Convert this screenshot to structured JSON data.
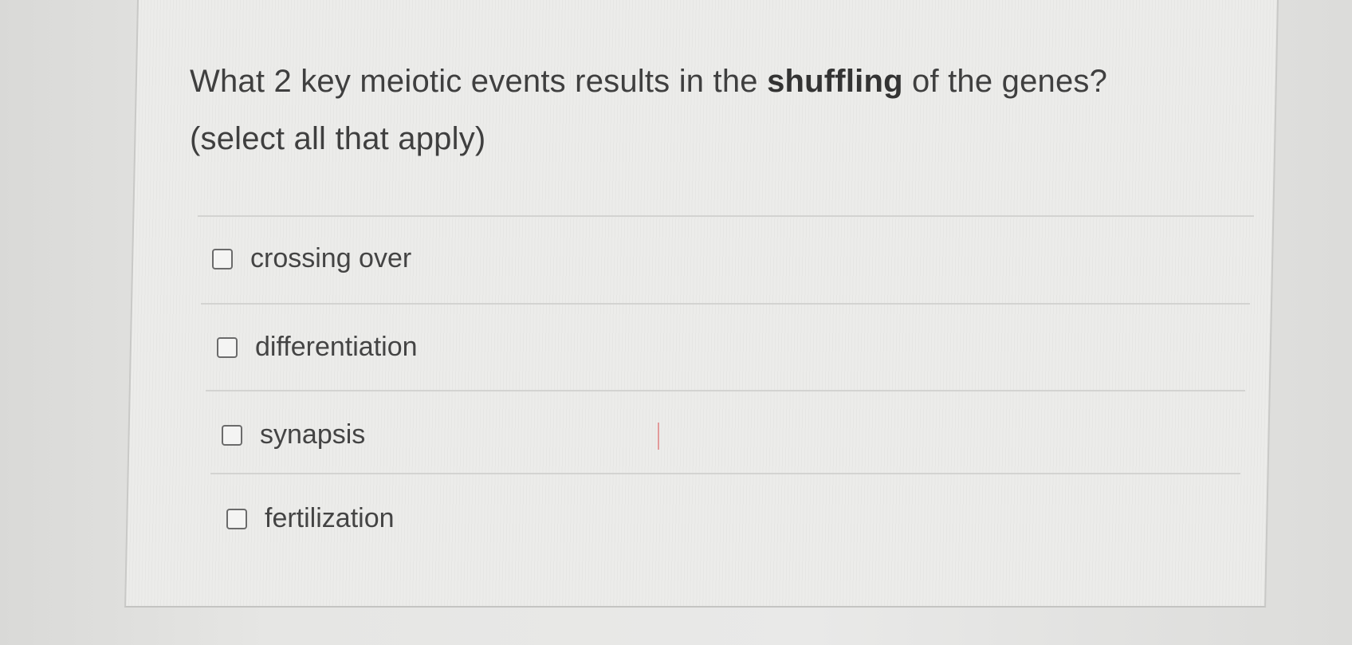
{
  "question": {
    "part1": "What 2 key meiotic events results in the ",
    "emphasis": "shuffling",
    "part2": " of the genes?",
    "instruction": "(select all that apply)"
  },
  "options": [
    {
      "label": "crossing over",
      "checked": false
    },
    {
      "label": "differentiation",
      "checked": false
    },
    {
      "label": "synapsis",
      "checked": false
    },
    {
      "label": "fertilization",
      "checked": false
    }
  ]
}
